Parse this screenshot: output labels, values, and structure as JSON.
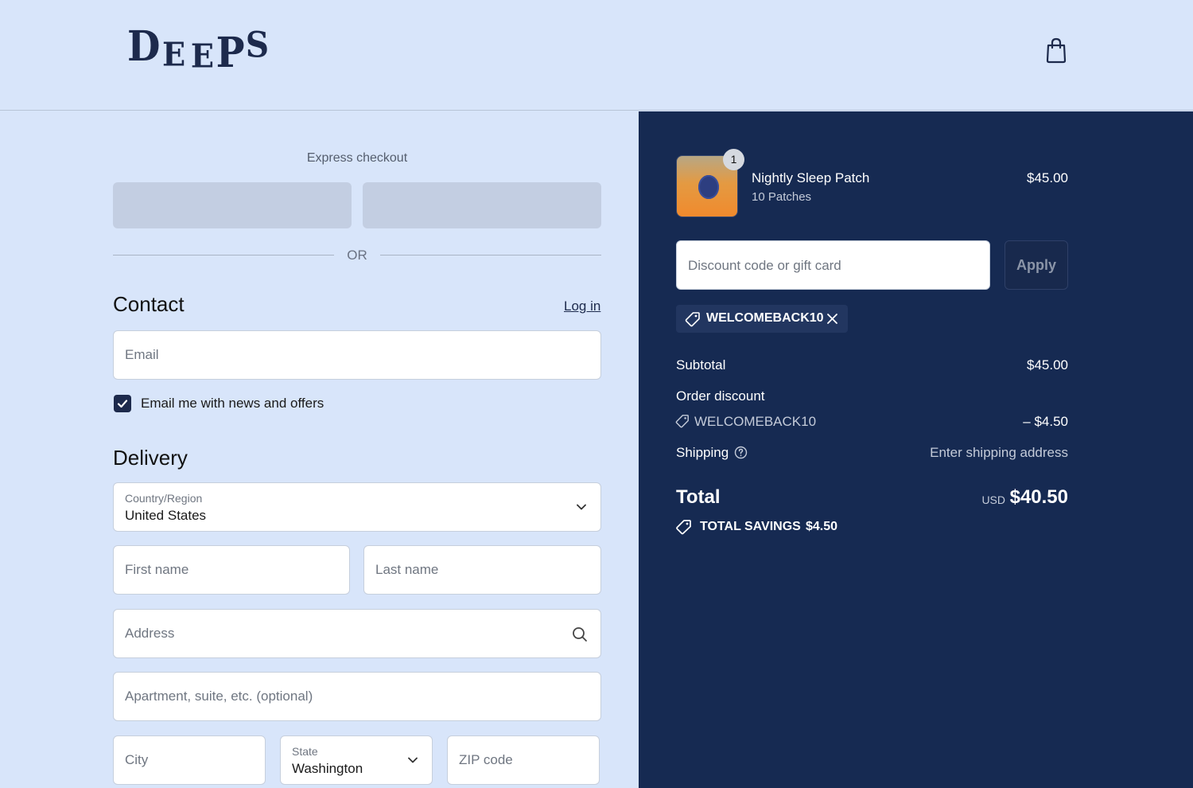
{
  "brand": {
    "logo_letters": [
      "D",
      "E",
      "E",
      "P",
      "S"
    ]
  },
  "header": {
    "cart_icon": "shopping-bag-icon"
  },
  "express": {
    "label": "Express checkout",
    "or_text": "OR"
  },
  "contact": {
    "title": "Contact",
    "login_link": "Log in",
    "email_placeholder": "Email",
    "newsletter_label": "Email me with news and offers",
    "newsletter_checked": true
  },
  "delivery": {
    "title": "Delivery",
    "country_label": "Country/Region",
    "country_value": "United States",
    "first_name_placeholder": "First name",
    "last_name_placeholder": "Last name",
    "address_placeholder": "Address",
    "apartment_placeholder": "Apartment, suite, etc. (optional)",
    "city_placeholder": "City",
    "state_label": "State",
    "state_value": "Washington",
    "zip_placeholder": "ZIP code"
  },
  "summary": {
    "product": {
      "name": "Nightly Sleep Patch",
      "variant": "10 Patches",
      "price": "$45.00",
      "quantity": "1"
    },
    "discount_placeholder": "Discount code or gift card",
    "apply_label": "Apply",
    "applied_code": "WELCOMEBACK10",
    "subtotal_label": "Subtotal",
    "subtotal_value": "$45.00",
    "order_discount_label": "Order discount",
    "discount_code": "WELCOMEBACK10",
    "discount_value": "– $4.50",
    "shipping_label": "Shipping",
    "shipping_value": "Enter shipping address",
    "total_label": "Total",
    "total_currency": "USD",
    "total_value": "$40.50",
    "savings_label": "TOTAL SAVINGS",
    "savings_value": "$4.50"
  },
  "colors": {
    "page_bg": "#d8e5fa",
    "summary_bg": "#162a52",
    "brand": "#1d2a4c"
  }
}
